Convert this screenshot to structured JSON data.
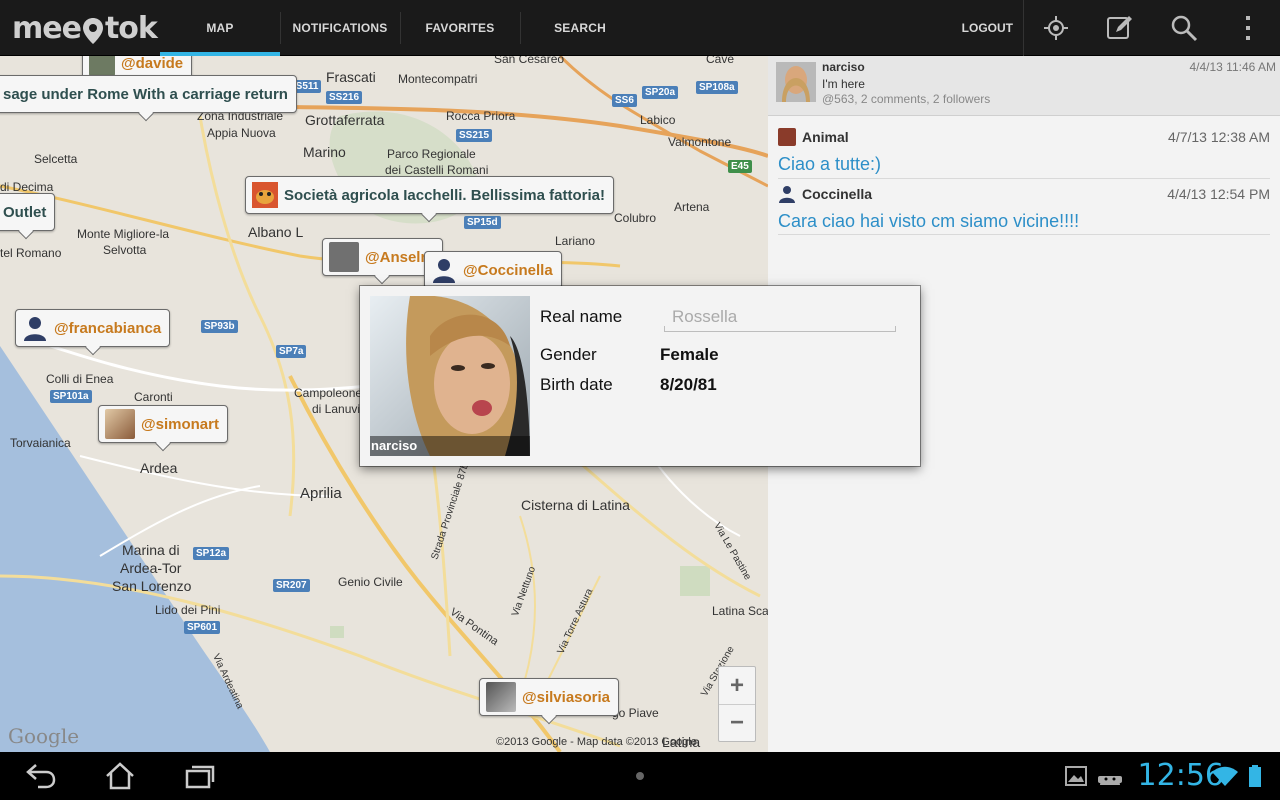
{
  "app": {
    "logo_text_start": "me",
    "logo_text_end": "tok",
    "logo_mid": "e"
  },
  "tabs": [
    {
      "label": "MAP",
      "active": true
    },
    {
      "label": "NOTIFICATIONS",
      "active": false
    },
    {
      "label": "FAVORITES",
      "active": false
    },
    {
      "label": "SEARCH",
      "active": false
    }
  ],
  "actionbar": {
    "logout_label": "LOGOUT",
    "icons": [
      "locate-icon",
      "compose-icon",
      "search-icon",
      "overflow-menu-icon"
    ]
  },
  "map": {
    "places": {
      "frascati": "Frascati",
      "montecompatri": "Montecompatri",
      "san_cesareo": "San Cesareo",
      "cave": "Cave",
      "zona_industriale": "Zona Industriale",
      "appia_nuova": "Appia Nuova",
      "grottaferrata": "Grottaferrata",
      "rocca_priora": "Rocca Priora",
      "labico": "Labico",
      "valmontone": "Valmontone",
      "selcetta": "Selcetta",
      "marino": "Marino",
      "parco_regionale": "Parco Regionale",
      "castelli_romani": "dei Castelli Romani",
      "decima": "di Decima",
      "artena": "Artena",
      "colubro": "Colubro",
      "monte_migliore": "Monte Migliore-la",
      "selvotta": "Selvotta",
      "albano": "Albano L",
      "romano": "tel Romano",
      "lariano": "Lariano",
      "colli_di_enea": "Colli di Enea",
      "caronti": "Caronti",
      "campoleone": "Campoleone",
      "lanuvio": "di Lanuvio",
      "torvaianica": "Torvaianica",
      "ardea": "Ardea",
      "aprilia": "Aprilia",
      "cisterna": "Cisterna di Latina",
      "marina_di": "Marina di",
      "ardea_tor": "Ardea-Tor",
      "san_lorenzo": "San Lorenzo",
      "genio_civile": "Genio Civile",
      "lido_dei_pini": "Lido dei Pini",
      "latina_scalo": "Latina Sca",
      "borgo_piave": "go Piave",
      "latina": "Latina",
      "via_pontina": "Via Pontina",
      "strada_prov": "Strada Provinciale 87b",
      "via_nettuno": "Via Nettuno",
      "via_torre_astura": "Via Torre Astura",
      "via_le_pastine": "Via Le Pastine",
      "via_ardeatina": "Via Ardeatina",
      "via_stazione": "Via Stazione"
    },
    "shields": {
      "ss511": "SS511",
      "ss216": "SS216",
      "ss215": "SS215",
      "ss6": "SS6",
      "sp20a": "SP20a",
      "sp108a": "SP108a",
      "e45": "E45",
      "sp15d": "SP15d",
      "sp93b": "SP93b",
      "sp7a": "SP7a",
      "sp101a": "SP101a",
      "sp12a": "SP12a",
      "sr207": "SR207",
      "sp601": "SP601"
    },
    "bubbles": {
      "davide": "@davide",
      "carriage": "sage under Rome With a carriage return",
      "outlet": "Outlet",
      "societa": "Società agricola Iacchelli. Bellissima fattoria!",
      "anselm": "@Anselm",
      "coccinella": "@Coccinella",
      "francabianca": "@francabianca",
      "simonart": "@simonart",
      "silviasoria": "@silviasoria"
    },
    "zoom_in": "+",
    "zoom_out": "−",
    "google_label": "Google",
    "copyright": "©2013 Google - Map data ©2013 Google"
  },
  "feed": {
    "post": {
      "user": "narciso",
      "text": "I'm here",
      "meta": "@563, 2 comments, 2 followers",
      "timestamp": "4/4/13 11:46 AM"
    },
    "comments": [
      {
        "user": "Animal",
        "timestamp": "4/7/13 12:38 AM",
        "text": "Ciao a tutte:)"
      },
      {
        "user": "Coccinella",
        "timestamp": "4/4/13 12:54 PM",
        "text": "Cara ciao hai visto cm siamo vicine!!!!"
      }
    ]
  },
  "dialog": {
    "photo_caption": "narciso",
    "real_name_label": "Real name",
    "real_name_value": "Rossella",
    "gender_label": "Gender",
    "gender_value": "Female",
    "birth_label": "Birth date",
    "birth_value": "8/20/81"
  },
  "navbar": {
    "clock": "12:56"
  },
  "colors": {
    "accent": "#33b5e5",
    "bubble_text": "#c77a1e",
    "comment_text": "#2d8fc8",
    "road": "#e6a35a"
  }
}
